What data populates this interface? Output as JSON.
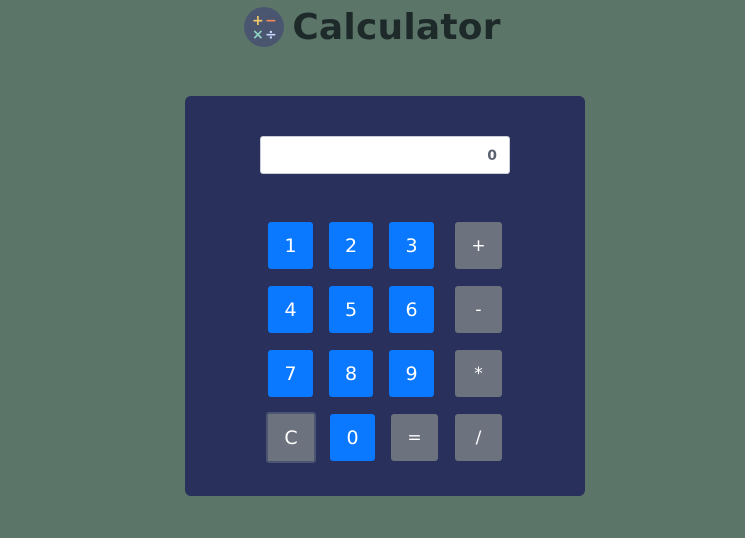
{
  "header": {
    "title": "Calculator",
    "logo_symbols": [
      "+",
      "−",
      "×",
      "÷"
    ]
  },
  "display": {
    "value": "0"
  },
  "keys": {
    "k1": "1",
    "k2": "2",
    "k3": "3",
    "plus": "+",
    "k4": "4",
    "k5": "5",
    "k6": "6",
    "minus": "-",
    "k7": "7",
    "k8": "8",
    "k9": "9",
    "multiply": "*",
    "clear": "C",
    "k0": "0",
    "equals": "=",
    "divide": "/"
  },
  "colors": {
    "background": "#5b7669",
    "panel": "#28305b",
    "number_key": "#0a78ff",
    "operator_key": "#6c737f",
    "display_bg": "#ffffff"
  }
}
